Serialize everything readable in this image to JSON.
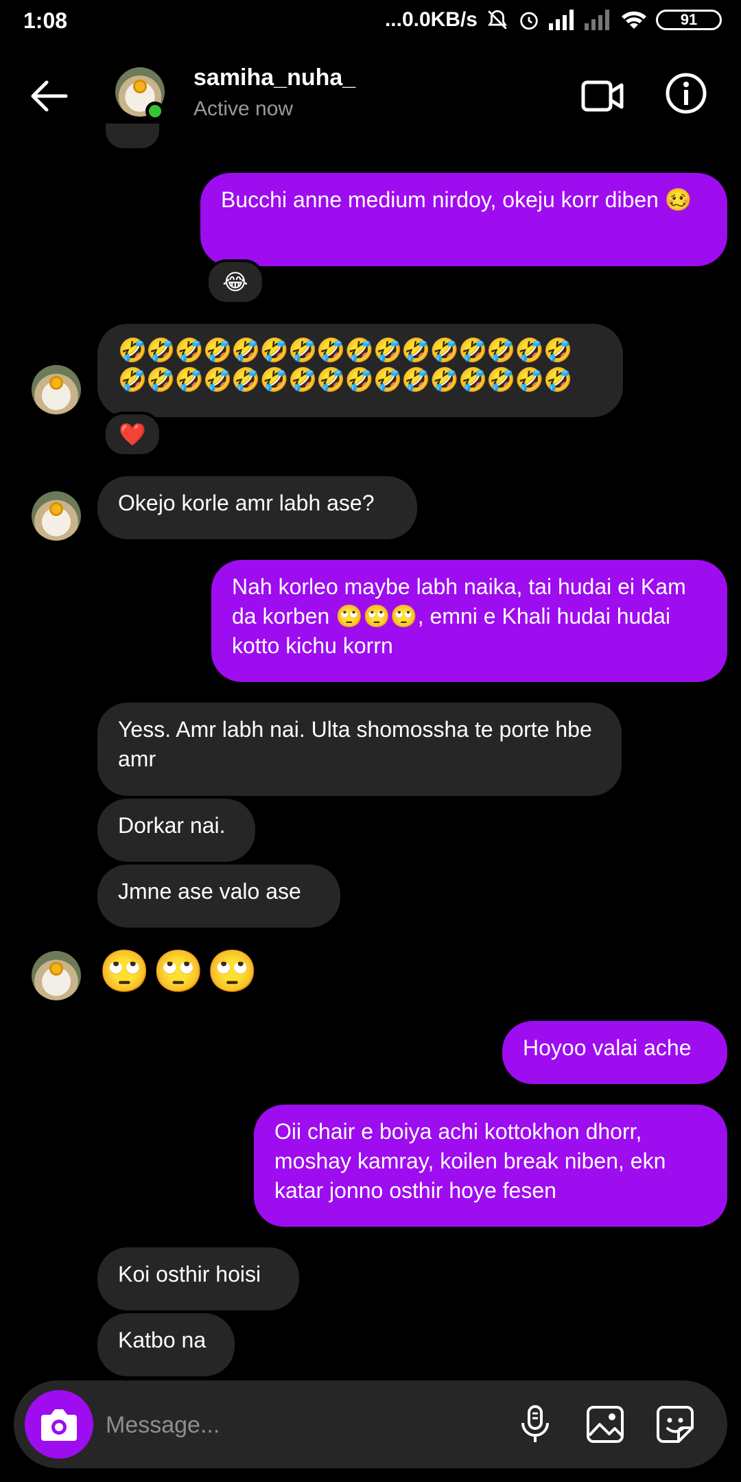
{
  "status": {
    "time": "1:08",
    "net": "...0.0KB/s",
    "battery": "91"
  },
  "header": {
    "username": "samiha_nuha_",
    "status": "Active now"
  },
  "thread": {
    "m1": "Bucchi anne medium nirdoy, okeju korr diben 🥴",
    "m1_reaction": "😂",
    "m2": "🤣🤣🤣🤣🤣🤣🤣🤣🤣🤣🤣🤣🤣🤣🤣🤣 🤣🤣🤣🤣🤣🤣🤣🤣🤣🤣🤣🤣🤣🤣🤣🤣",
    "m2_reaction": "❤️",
    "m3": "Okejo korle amr labh ase?",
    "m4": "Nah korleo maybe labh naika, tai hudai ei Kam da korben 🙄🙄🙄, emni e Khali hudai hudai kotto kichu korrn",
    "m5": "Yess. Amr labh nai. Ulta shomossha te porte hbe amr",
    "m6": "Dorkar nai.",
    "m7": "Jmne ase valo ase",
    "m8": "🙄🙄🙄",
    "m9": "Hoyoo valai ache",
    "m10": "Oii chair e boiya achi kottokhon dhorr, moshay kamray, koilen break niben, ekn katar jonno osthir hoye fesen",
    "m11": "Koi osthir hoisi",
    "m12": "Katbo na"
  },
  "composer": {
    "placeholder": "Message..."
  },
  "colors": {
    "outgoing": "#9e0cf0",
    "incoming": "#262626",
    "online": "#34c534"
  }
}
